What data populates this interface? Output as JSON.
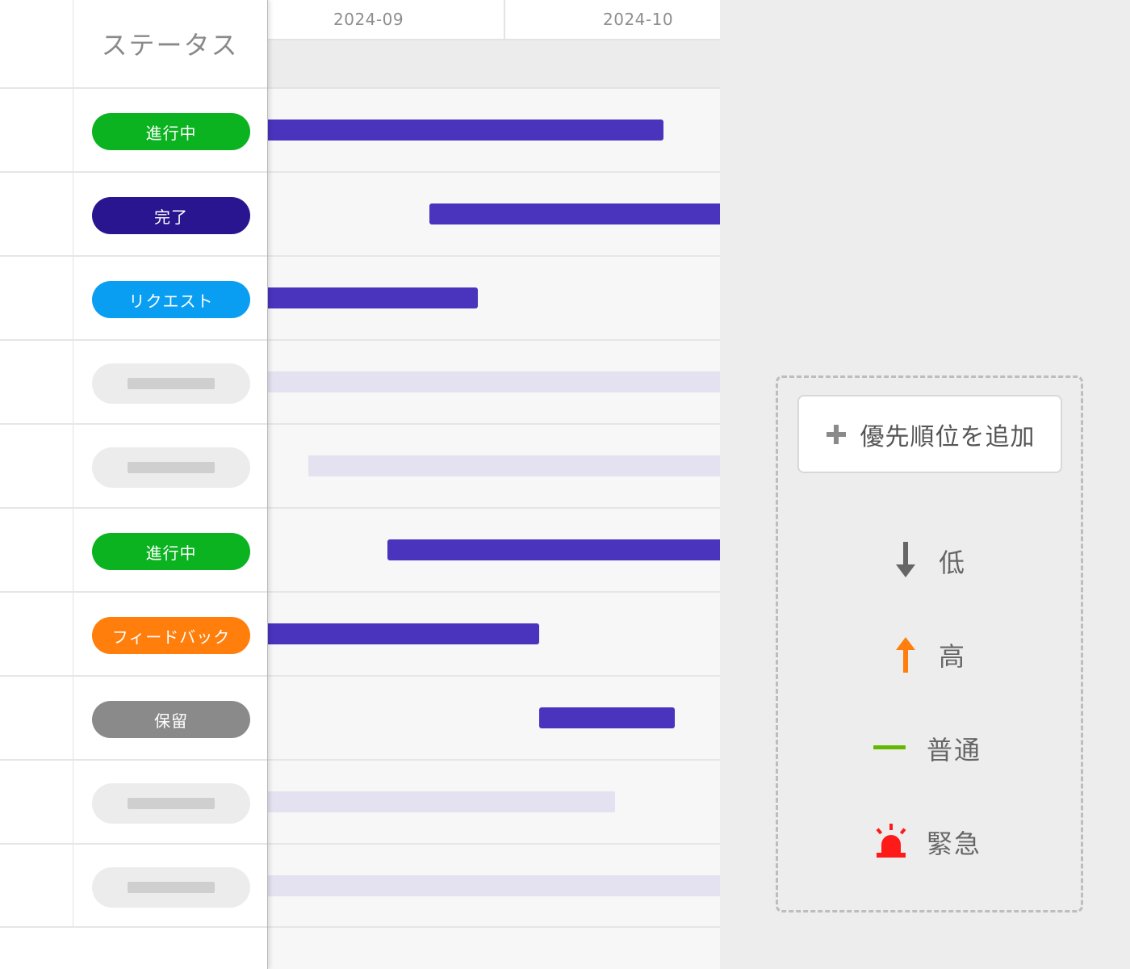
{
  "columns": {
    "status_header": "ステータス"
  },
  "timeline": {
    "months": [
      "2024-09",
      "2024-10"
    ]
  },
  "rows": [
    {
      "status": "進行中",
      "kind": "inprogress"
    },
    {
      "status": "完了",
      "kind": "done"
    },
    {
      "status": "リクエスト",
      "kind": "request"
    },
    {
      "status": "",
      "kind": "empty"
    },
    {
      "status": "",
      "kind": "empty"
    },
    {
      "status": "進行中",
      "kind": "inprogress"
    },
    {
      "status": "フィードバック",
      "kind": "feedback"
    },
    {
      "status": "保留",
      "kind": "hold"
    },
    {
      "status": "",
      "kind": "empty"
    },
    {
      "status": "",
      "kind": "empty"
    }
  ],
  "status_colors": {
    "inprogress": "#0bb320",
    "done": "#2a1591",
    "request": "#0a9ef2",
    "feedback": "#ff7e0c",
    "hold": "#8a8a8a"
  },
  "legend": {
    "add_button_label": "優先順位を追加",
    "add_icon": "plus-icon",
    "items": [
      {
        "label": "低",
        "icon": "arrow-down-icon",
        "color": "#666666"
      },
      {
        "label": "高",
        "icon": "arrow-up-icon",
        "color": "#ff7e0c"
      },
      {
        "label": "普通",
        "icon": "dash-icon",
        "color": "#64b800"
      },
      {
        "label": "緊急",
        "icon": "siren-icon",
        "color": "#ff1a1a"
      }
    ]
  }
}
